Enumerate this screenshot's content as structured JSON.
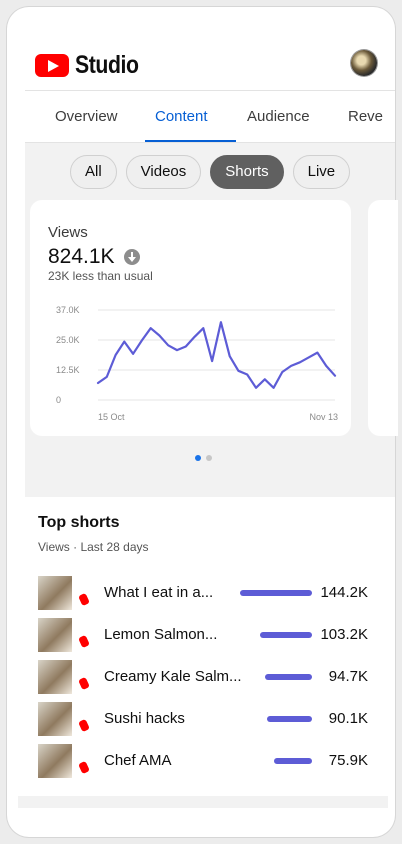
{
  "app": {
    "title": "Studio"
  },
  "tabs": [
    {
      "label": "Overview",
      "active": false
    },
    {
      "label": "Content",
      "active": true
    },
    {
      "label": "Audience",
      "active": false
    },
    {
      "label": "Reve",
      "active": false
    }
  ],
  "chips": [
    {
      "label": "All",
      "active": false
    },
    {
      "label": "Videos",
      "active": false
    },
    {
      "label": "Shorts",
      "active": true
    },
    {
      "label": "Live",
      "active": false
    }
  ],
  "card": {
    "metric_label": "Views",
    "metric_value": "824.1K",
    "metric_sub": "23K less than usual",
    "trend_icon": "arrow-down-circle-icon"
  },
  "chart_data": {
    "type": "line",
    "x_labels": [
      "15 Oct",
      "Nov 13"
    ],
    "y_ticks": [
      "37.0K",
      "25.0K",
      "12.5K",
      "0"
    ],
    "ylim": [
      0,
      37000
    ],
    "grid": true,
    "series": [
      {
        "values": [
          7000,
          9500,
          18500,
          24000,
          19000,
          24500,
          29500,
          26500,
          22500,
          20500,
          22000,
          26000,
          29500,
          16000,
          32000,
          18000,
          12000,
          10500,
          5000,
          8500,
          5000,
          11500,
          14000,
          15500,
          17500,
          19500,
          14000,
          10000
        ]
      }
    ],
    "color": "#5d5cd6"
  },
  "pager": {
    "count": 2,
    "active": 0
  },
  "top_shorts": {
    "title": "Top shorts",
    "subtitle": "Views · Last 28 days",
    "items": [
      {
        "title": "What I eat in a...",
        "value": "144.2K",
        "views": 144200
      },
      {
        "title": "Lemon Salmon...",
        "value": "103.2K",
        "views": 103200
      },
      {
        "title": "Creamy Kale Salm...",
        "value": "94.7K",
        "views": 94700
      },
      {
        "title": "Sushi hacks",
        "value": "90.1K",
        "views": 90100
      },
      {
        "title": "Chef AMA",
        "value": "75.9K",
        "views": 75900
      }
    ]
  },
  "colors": {
    "accent": "#065fd4",
    "brand": "#ff0000",
    "bar": "#5d5cd6"
  }
}
